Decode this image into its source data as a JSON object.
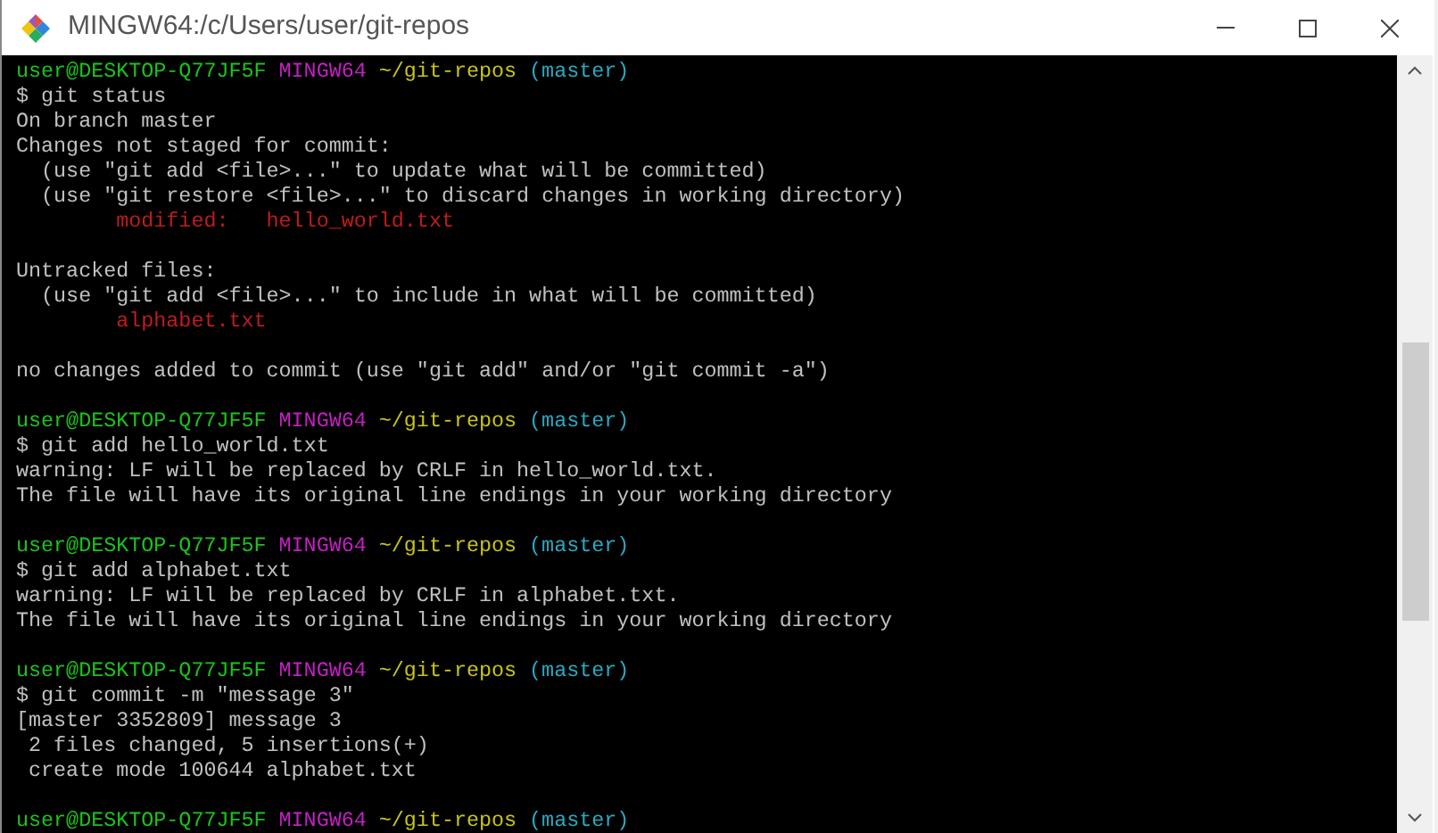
{
  "window": {
    "title": "MINGW64:/c/Users/user/git-repos"
  },
  "terminal": {
    "lines": [
      {
        "kind": "prompt",
        "user": "user@DESKTOP-Q77JF5F",
        "system": "MINGW64",
        "path": "~/git-repos",
        "branch": "(master)"
      },
      {
        "kind": "text",
        "text": "$ git status"
      },
      {
        "kind": "text",
        "text": "On branch master"
      },
      {
        "kind": "text",
        "text": "Changes not staged for commit:"
      },
      {
        "kind": "text",
        "text": "  (use \"git add <file>...\" to update what will be committed)"
      },
      {
        "kind": "text",
        "text": "  (use \"git restore <file>...\" to discard changes in working directory)"
      },
      {
        "kind": "red",
        "text": "        modified:   hello_world.txt"
      },
      {
        "kind": "blank"
      },
      {
        "kind": "text",
        "text": "Untracked files:"
      },
      {
        "kind": "text",
        "text": "  (use \"git add <file>...\" to include in what will be committed)"
      },
      {
        "kind": "red",
        "text": "        alphabet.txt"
      },
      {
        "kind": "blank"
      },
      {
        "kind": "text",
        "text": "no changes added to commit (use \"git add\" and/or \"git commit -a\")"
      },
      {
        "kind": "blank"
      },
      {
        "kind": "prompt",
        "user": "user@DESKTOP-Q77JF5F",
        "system": "MINGW64",
        "path": "~/git-repos",
        "branch": "(master)"
      },
      {
        "kind": "text",
        "text": "$ git add hello_world.txt"
      },
      {
        "kind": "text",
        "text": "warning: LF will be replaced by CRLF in hello_world.txt."
      },
      {
        "kind": "text",
        "text": "The file will have its original line endings in your working directory"
      },
      {
        "kind": "blank"
      },
      {
        "kind": "prompt",
        "user": "user@DESKTOP-Q77JF5F",
        "system": "MINGW64",
        "path": "~/git-repos",
        "branch": "(master)"
      },
      {
        "kind": "text",
        "text": "$ git add alphabet.txt"
      },
      {
        "kind": "text",
        "text": "warning: LF will be replaced by CRLF in alphabet.txt."
      },
      {
        "kind": "text",
        "text": "The file will have its original line endings in your working directory"
      },
      {
        "kind": "blank"
      },
      {
        "kind": "prompt",
        "user": "user@DESKTOP-Q77JF5F",
        "system": "MINGW64",
        "path": "~/git-repos",
        "branch": "(master)"
      },
      {
        "kind": "text",
        "text": "$ git commit -m \"message 3\""
      },
      {
        "kind": "text",
        "text": "[master 3352809] message 3"
      },
      {
        "kind": "text",
        "text": " 2 files changed, 5 insertions(+)"
      },
      {
        "kind": "text",
        "text": " create mode 100644 alphabet.txt"
      },
      {
        "kind": "blank"
      },
      {
        "kind": "prompt",
        "user": "user@DESKTOP-Q77JF5F",
        "system": "MINGW64",
        "path": "~/git-repos",
        "branch": "(master)"
      }
    ]
  }
}
